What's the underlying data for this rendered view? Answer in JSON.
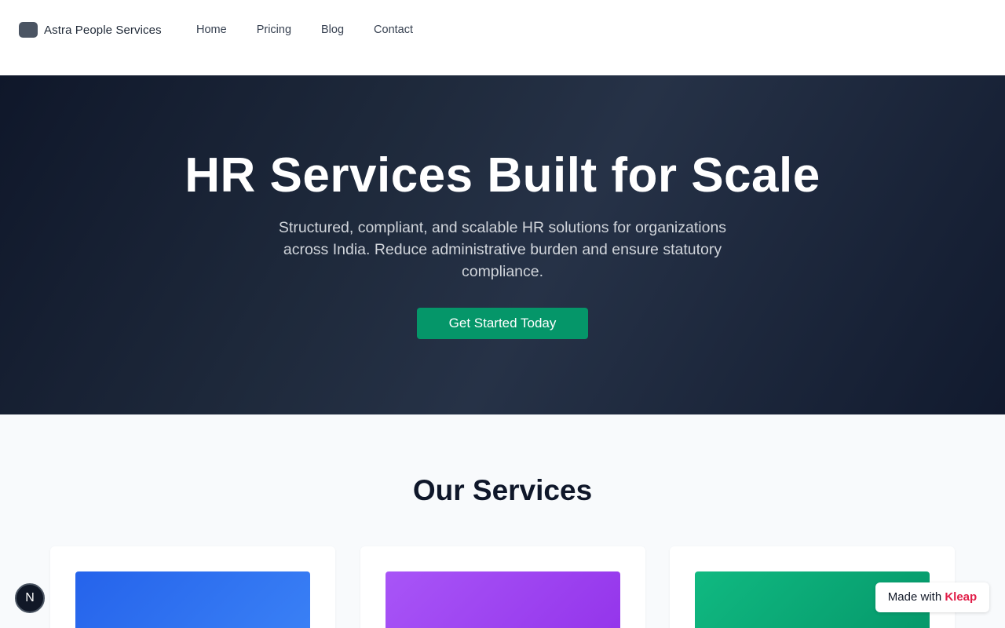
{
  "brand": {
    "name": "Astra People Services",
    "logo_icon": "logo-square-icon"
  },
  "nav": {
    "items": [
      {
        "label": "Home"
      },
      {
        "label": "Pricing"
      },
      {
        "label": "Blog"
      },
      {
        "label": "Contact"
      }
    ]
  },
  "hero": {
    "title": "HR Services Built for Scale",
    "subtitle": "Structured, compliant, and scalable HR solutions for organizations across India. Reduce administrative burden and ensure statutory compliance.",
    "cta_label": "Get Started Today"
  },
  "services": {
    "title": "Our Services",
    "cards": [
      {
        "color": "#2563eb",
        "icon": "arrow-up-icon"
      },
      {
        "color": "#9333ea",
        "icon": "document-icon"
      },
      {
        "color": "#10b981",
        "icon": "users-icon"
      }
    ]
  },
  "floating": {
    "framework_badge": "N",
    "made_with_prefix": "Made with",
    "made_with_brand": "Kleap"
  },
  "colors": {
    "cta": "#059669",
    "hero_bg": "#1e293b",
    "kleap": "#e11d48"
  }
}
